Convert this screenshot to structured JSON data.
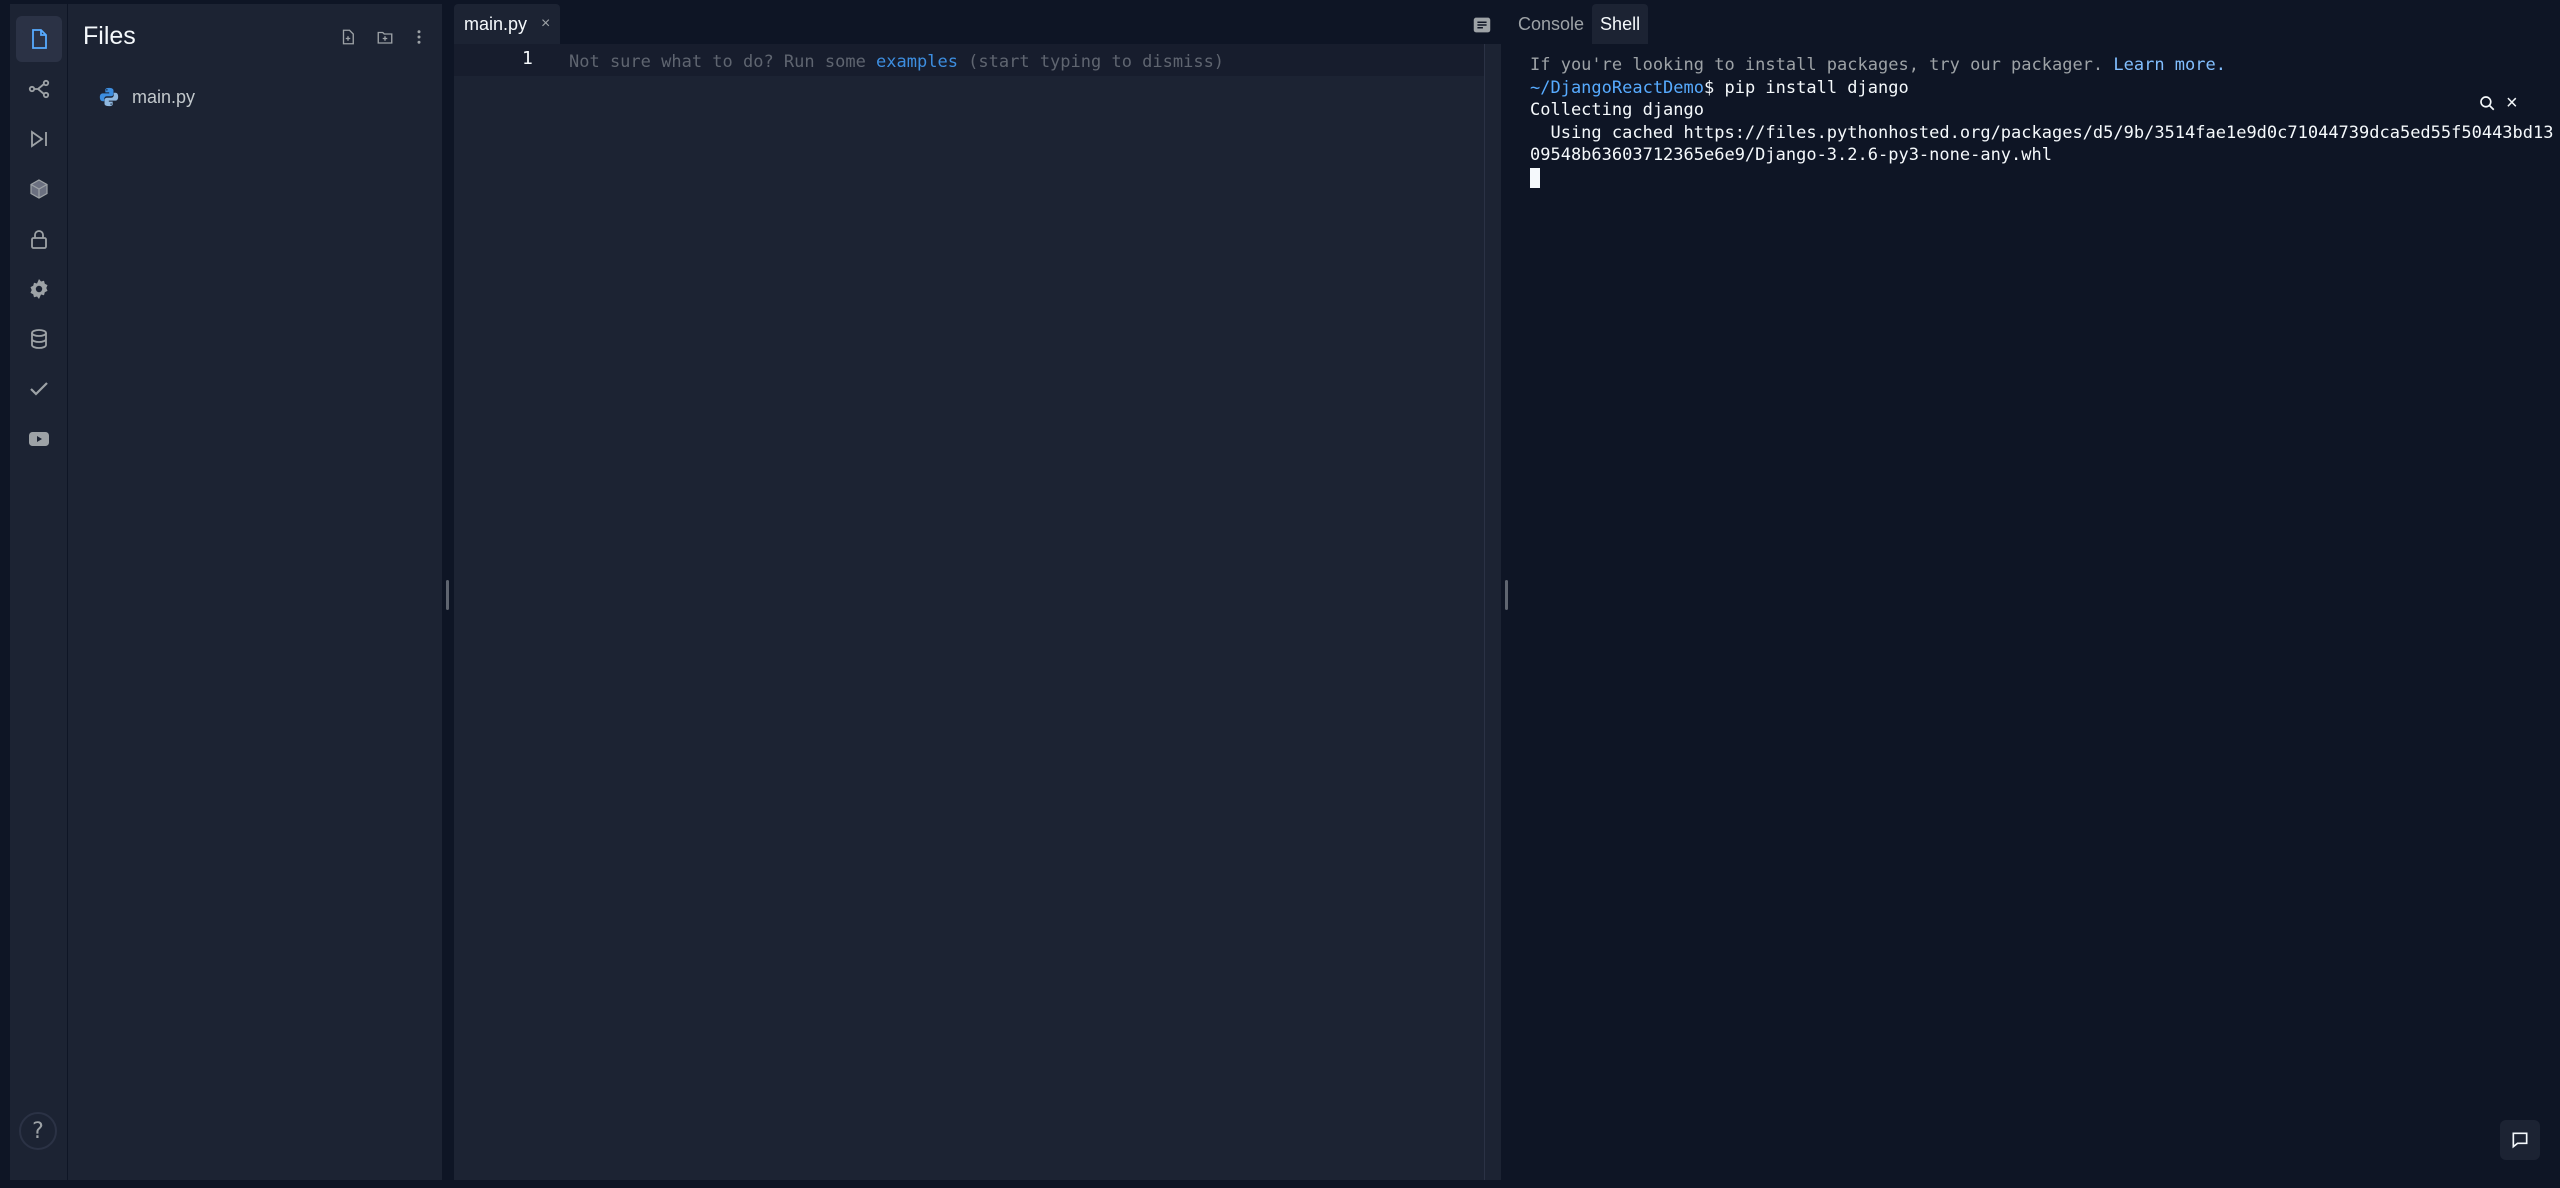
{
  "sidebar": {
    "icons": [
      "files-icon",
      "version-control-icon",
      "run-icon",
      "packages-icon",
      "secrets-icon",
      "settings-icon",
      "database-icon",
      "unit-tests-icon",
      "video-icon"
    ],
    "help_label": "?"
  },
  "files_panel": {
    "title": "Files",
    "files": [
      {
        "name": "main.py",
        "icon": "python-icon"
      }
    ]
  },
  "editor": {
    "tab_label": "main.py",
    "tab_close": "×",
    "line_number": "1",
    "hint_prefix": "Not sure what to do? Run some ",
    "hint_link": "examples",
    "hint_suffix": " (start typing to dismiss)"
  },
  "shell": {
    "tabs": [
      {
        "label": "Console",
        "active": false
      },
      {
        "label": "Shell",
        "active": true
      }
    ],
    "notice_text": "If you're looking to install packages, try our packager. ",
    "notice_link": "Learn more.",
    "cwd": "~/DjangoReactDemo",
    "prompt_cmd": "$ pip install django",
    "output_line_1": "Collecting django",
    "output_line_2": "  Using cached https://files.pythonhosted.org/packages/d5/9b/3514fae1e9d0c71044739dca5ed55f50443bd13",
    "output_line_3": "09548b63603712365e6e9/Django-3.2.6-py3-none-any.whl",
    "close_label": "×"
  },
  "colors": {
    "background": "#0e1525",
    "panel": "#1c2333",
    "accent": "#3d8ee0",
    "muted": "#9da2a6"
  }
}
